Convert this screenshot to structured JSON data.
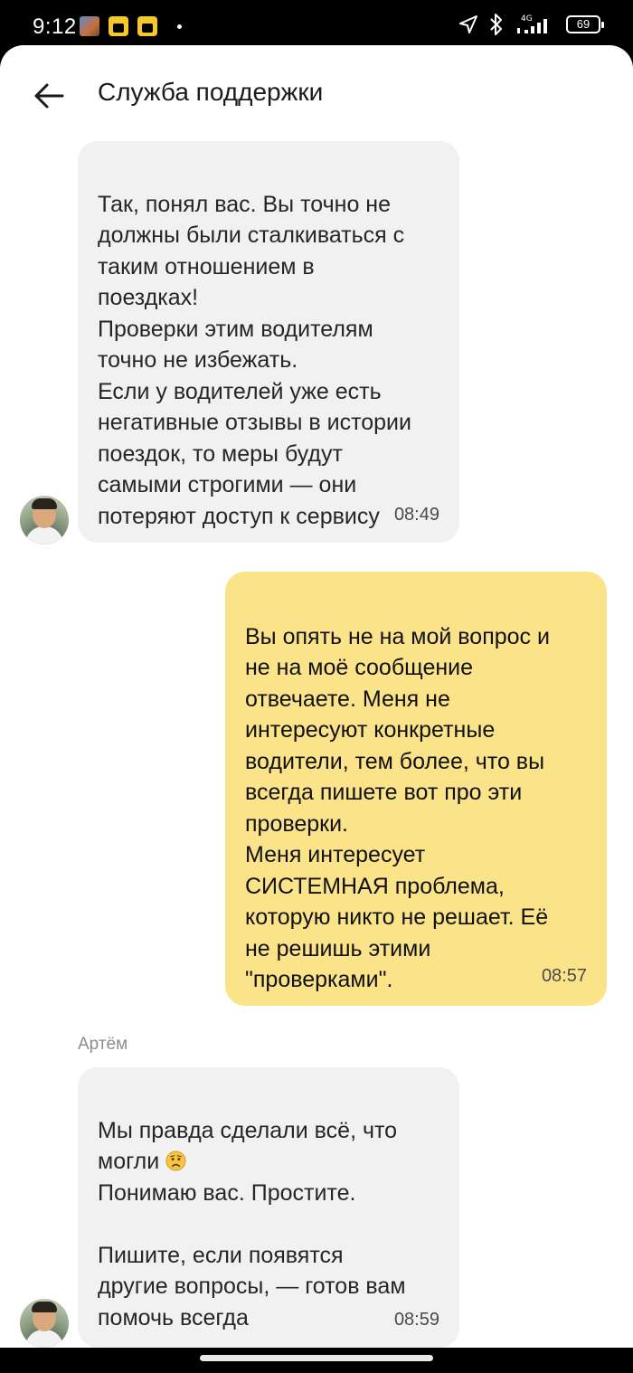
{
  "status_bar": {
    "time": "9:12",
    "network": "4G",
    "battery": "69"
  },
  "header": {
    "back_icon": "arrow-left-icon",
    "title": "Служба поддержки"
  },
  "messages": [
    {
      "direction": "incoming",
      "text": "Так, понял вас. Вы точно не\nдолжны были сталкиваться с\nтаким отношением в\nпоездках!\nПроверки этим водителям\nточно не избежать.\nЕсли у водителей уже есть\nнегативные отзывы в истории\nпоездок, то меры будут\nсамыми строгими — они\nпотеряют доступ к сервису",
      "time": "08:49"
    },
    {
      "direction": "outgoing",
      "text": "Вы опять не на мой вопрос и\nне на моё сообщение\nотвечаете. Меня не\nинтересуют конкретные\nводители, тем более, что вы\nвсегда пишете вот про эти\nпроверки.\nМеня интересует\nСИСТЕМНАЯ проблема,\nкоторую никто не решает. Её\nне решишь этими\n\"проверками\".",
      "time": "08:57"
    },
    {
      "direction": "incoming",
      "sender": "Артём",
      "text_line1": "Мы правда сделали всё, что",
      "text_line2": "могли",
      "emoji": "worried-face-icon",
      "text_rest": "Понимаю вас. Простите.\n\nПишите, если появятся\nдругие вопросы, — готов вам\nпомочь всегда",
      "time": "08:59"
    }
  ],
  "colors": {
    "incoming_bubble": "#f1f1f1",
    "outgoing_bubble": "#fbe38a",
    "app_background": "#ffffff",
    "status_bar": "#000000"
  }
}
